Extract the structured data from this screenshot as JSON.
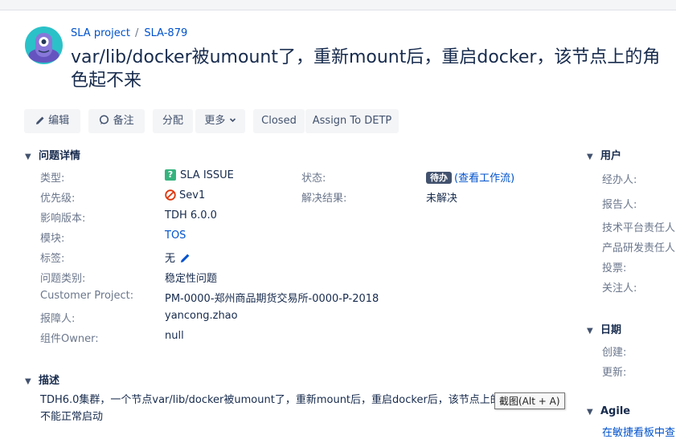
{
  "breadcrumb": {
    "project": "SLA project",
    "issue_key": "SLA-879"
  },
  "issue_title": "var/lib/docker被umount了，重新mount后，重启docker，该节点上的角色起不来",
  "toolbar": {
    "edit": "编辑",
    "comment": "备注",
    "assign": "分配",
    "more": "更多",
    "closed": "Closed",
    "assign_to": "Assign To DETP"
  },
  "details": {
    "heading": "问题详情",
    "type_label": "类型:",
    "type_value": "SLA ISSUE",
    "type_icon": "?",
    "priority_label": "优先级:",
    "priority_value": "Sev1",
    "affects_label": "影响版本:",
    "affects_value": "TDH 6.0.0",
    "component_label": "模块:",
    "component_value": "TOS",
    "labels_label": "标签:",
    "labels_value": "无",
    "category_label": "问题类别:",
    "category_value": "稳定性问题",
    "customer_label": "Customer Project:",
    "customer_value": "PM-0000-郑州商品期货交易所-0000-P-2018",
    "reporter_label": "报障人:",
    "reporter_value": "yancong.zhao",
    "owner_label": "组件Owner:",
    "owner_value": "null",
    "status_label": "状态:",
    "status_badge": "待办",
    "status_link": "(查看工作流)",
    "resolution_label": "解决结果:",
    "resolution_value": "未解决"
  },
  "description": {
    "heading": "描述",
    "text": "TDH6.0集群，一个节点var/lib/docker被umount了，重新mount后，重启docker后，该节点上的角色不能正常启动"
  },
  "tooltip": "截图(Alt + A)",
  "people": {
    "heading": "用户",
    "assignee": "经办人:",
    "reporter": "报告人:",
    "tech_owner": "技术平台责任人",
    "product_owner": "产品研发责任人",
    "votes": "投票:",
    "watchers": "关注人:"
  },
  "dates": {
    "heading": "日期",
    "created": "创建:",
    "updated": "更新:"
  },
  "agile": {
    "heading": "Agile",
    "link": "在敏捷看板中查"
  },
  "colors": {
    "accent": "#0052cc",
    "success": "#36b37e",
    "danger": "#de350b",
    "status": "#42526e"
  }
}
